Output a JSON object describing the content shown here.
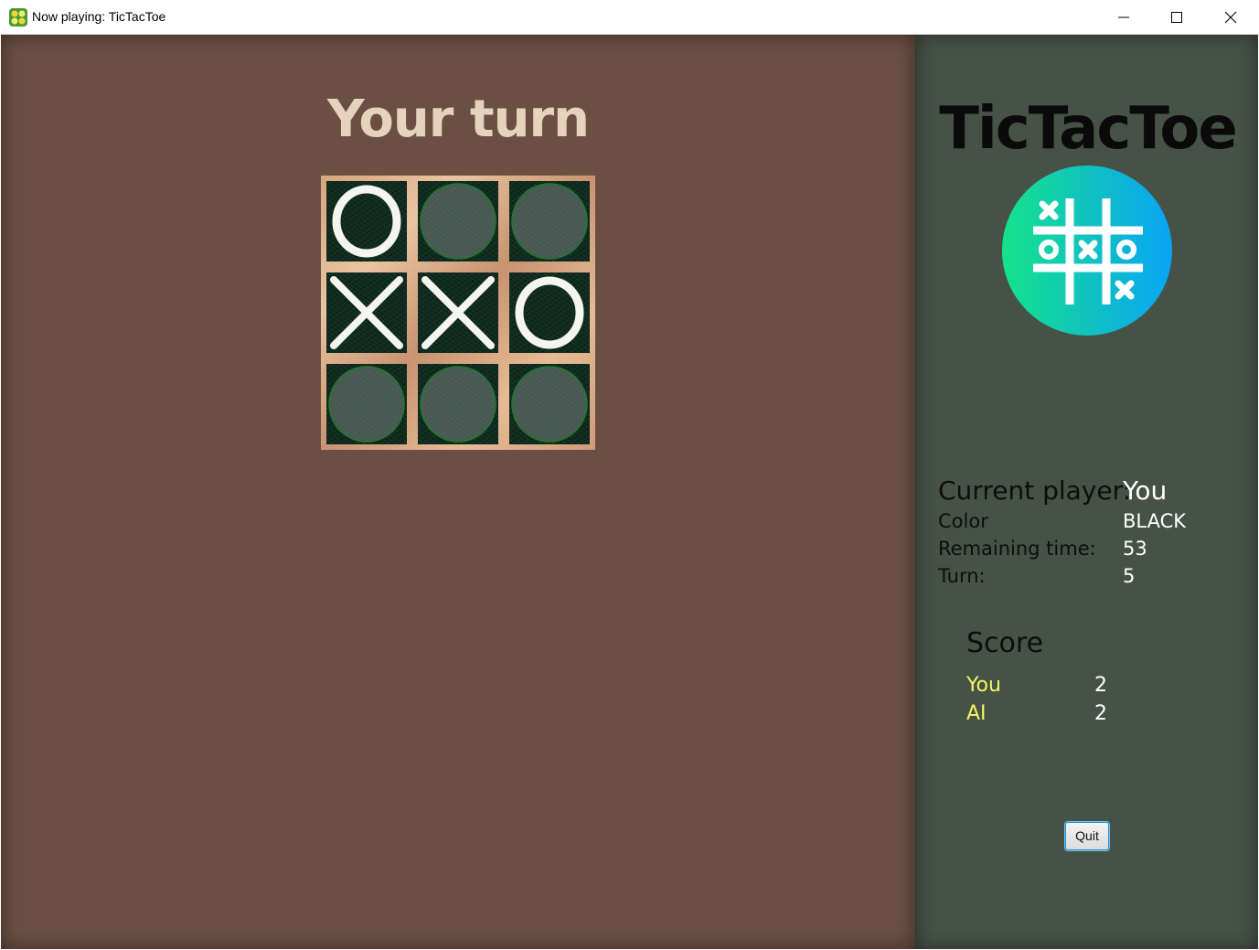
{
  "window": {
    "title": "Now playing: TicTacToe",
    "icon": "game-controller-icon",
    "controls": [
      "minimize-icon",
      "maximize-icon",
      "close-icon"
    ]
  },
  "game": {
    "status": "Your turn",
    "board": [
      [
        "O",
        "",
        ""
      ],
      [
        "X",
        "X",
        "O"
      ],
      [
        "",
        "",
        ""
      ]
    ]
  },
  "panel": {
    "app_name": "TicTacToe",
    "logo": "tictactoe-logo-icon",
    "current_player_label": "Current player:",
    "current_player_value": "You",
    "color_label": "Color",
    "color_value": "BLACK",
    "remaining_time_label": "Remaining time:",
    "remaining_time_value": "53",
    "turn_label": "Turn:",
    "turn_value": "5",
    "score_title": "Score",
    "scores": [
      {
        "name": "You",
        "value": "2"
      },
      {
        "name": "AI",
        "value": "2"
      }
    ],
    "quit_label": "Quit"
  },
  "colors": {
    "game_background": "#6b4f43",
    "panel_background": "#465246",
    "status_text": "#e6d3bd",
    "score_names": "#f5f566"
  }
}
